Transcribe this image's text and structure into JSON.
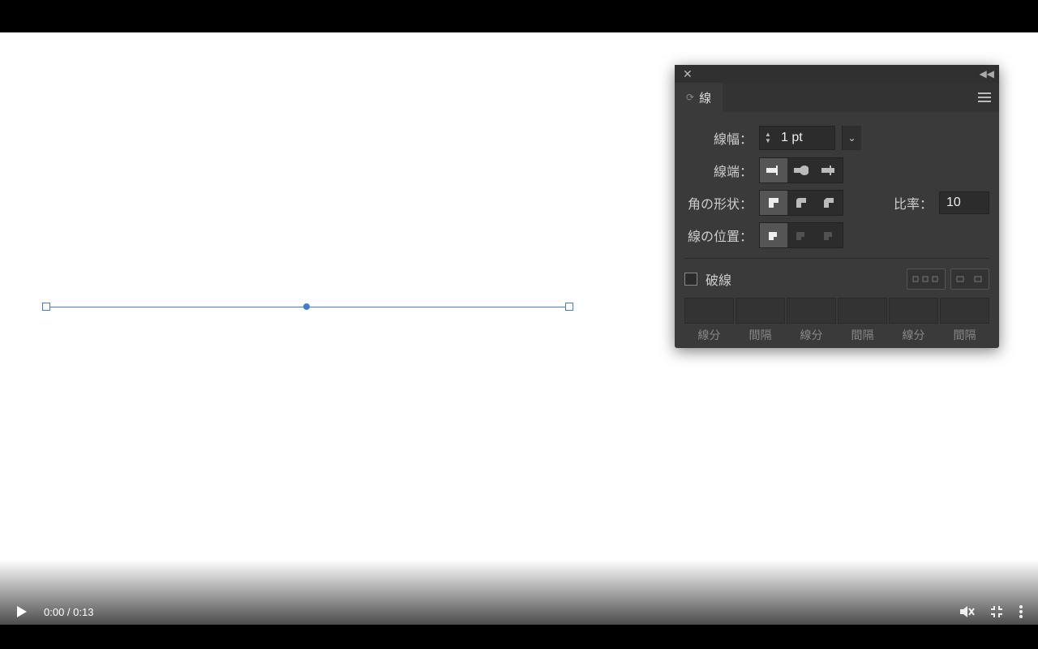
{
  "panel": {
    "tab_title": "線",
    "stroke_width_label": "線幅：",
    "stroke_width_value": "1 pt",
    "cap_label": "線端：",
    "join_label": "角の形状：",
    "ratio_label": "比率：",
    "ratio_value": "10",
    "align_label": "線の位置：",
    "dashed_label": "破線",
    "dash_columns": [
      "線分",
      "間隔",
      "線分",
      "間隔",
      "線分",
      "間隔"
    ]
  },
  "video": {
    "current_time": "0:00",
    "duration": "0:13",
    "time_display": "0:00 / 0:13"
  }
}
